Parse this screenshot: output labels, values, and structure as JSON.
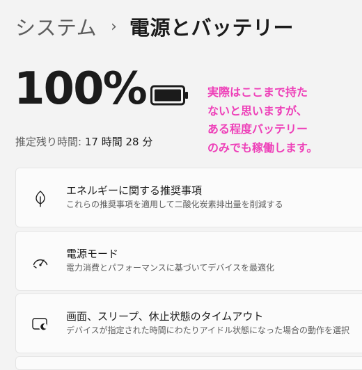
{
  "breadcrumb": {
    "parent": "システム",
    "separator": "›",
    "current": "電源とバッテリー"
  },
  "battery": {
    "percent_label": "100%",
    "percent_value": 100,
    "icon": "battery-full-icon",
    "remaining_label": "推定残り時間:",
    "remaining_value": "17 時間 28 分"
  },
  "annotation": {
    "color": "#ee3fb8",
    "lines": [
      "実際はここまで持た",
      "ないと思いますが、",
      "ある程度バッテリー",
      "のみでも稼働します。"
    ]
  },
  "cards": [
    {
      "icon": "leaf-icon",
      "title": "エネルギーに関する推奨事項",
      "subtitle": "これらの推奨事項を適用して二酸化炭素排出量を削減する"
    },
    {
      "icon": "speedometer-icon",
      "title": "電源モード",
      "subtitle": "電力消費とパフォーマンスに基づいてデバイスを最適化"
    },
    {
      "icon": "screen-sleep-icon",
      "title": "画面、スリープ、休止状態のタイムアウト",
      "subtitle": "デバイスが指定された時間にわたりアイドル状態になった場合の動作を選択"
    }
  ]
}
